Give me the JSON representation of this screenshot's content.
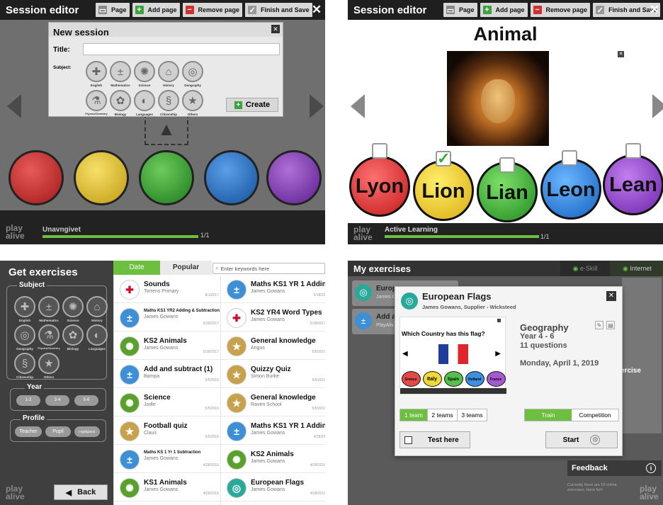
{
  "p1": {
    "title": "Session editor",
    "toolbar": {
      "page": "Page",
      "add": "Add page",
      "remove": "Remove page",
      "finish": "Finish and Save"
    },
    "dialog": {
      "heading": "New session",
      "title_label": "Title:",
      "title_value": "",
      "subject_label": "Subject:",
      "create": "Create",
      "subjects": [
        "English",
        "Mathematics",
        "Science",
        "History",
        "Geography",
        "Physics/Chemistry",
        "Biology",
        "Languages",
        "Citizenship",
        "Others"
      ]
    },
    "session_name": "Unavngivet",
    "page_count": "1/1",
    "logo": "play alive"
  },
  "p2": {
    "title": "Session editor",
    "toolbar": {
      "page": "Page",
      "add": "Add page",
      "remove": "Remove page",
      "finish": "Finish and Save"
    },
    "heading": "Animal",
    "answers": [
      "Lyon",
      "Lion",
      "Lian",
      "Leon",
      "Lean"
    ],
    "session_name": "Active Learning",
    "page_count": "1/1",
    "logo": "play alive"
  },
  "p3": {
    "title": "Get exercises",
    "subject_label": "Subject",
    "subjects": [
      "English",
      "Mathematics",
      "Science",
      "History",
      "Geography",
      "Physics/Chemistry",
      "Biology",
      "Languages",
      "Citizenship",
      "Others"
    ],
    "year_label": "Year",
    "years": [
      "1-2",
      "3-4",
      "5-6"
    ],
    "profile_label": "Profile",
    "profiles": [
      "Teacher",
      "Pupil",
      "Highlighted"
    ],
    "back": "Back",
    "logo": "play alive",
    "tabs": {
      "date": "Date",
      "popular": "Popular"
    },
    "search_placeholder": "Enter keywords here",
    "left_col": [
      {
        "title": "Sounds",
        "author": "Torrens Primary",
        "date": "8/1/2017",
        "icon": "uk-flag-icon",
        "small": false
      },
      {
        "title": "Maths KS1 YR2 Adding & Subtraction",
        "author": "James Gowans",
        "date": "5/18/2017",
        "icon": "math-icon",
        "small": true
      },
      {
        "title": "KS2 Animals",
        "author": "James Gowans",
        "date": "5/18/2017",
        "icon": "science-icon",
        "small": false
      },
      {
        "title": "Add and subtract (1)",
        "author": "Bampa",
        "date": "5/5/2016",
        "icon": "math-icon",
        "small": false
      },
      {
        "title": "Science",
        "author": "Jodle",
        "date": "5/5/2016",
        "icon": "science-icon",
        "small": false
      },
      {
        "title": "Football quiz",
        "author": "Claus",
        "date": "5/5/2016",
        "icon": "star-icon",
        "small": false
      },
      {
        "title": "Maths KS 1 Yr 1 Subtraction",
        "author": "James Gowans",
        "date": "4/28/2016",
        "icon": "math-icon",
        "small": true
      },
      {
        "title": "KS1 Animals",
        "author": "James Gowans",
        "date": "4/28/2016",
        "icon": "science-icon",
        "small": false
      }
    ],
    "right_col": [
      {
        "title": "Maths KS1 YR 1 Adding",
        "author": "James Gowans",
        "date": "5/18/2017",
        "icon": "math-icon",
        "small": false
      },
      {
        "title": "KS2 YR4 Word Types",
        "author": "James Gowans",
        "date": "5/18/2017",
        "icon": "uk-flag-icon",
        "small": false
      },
      {
        "title": "General knowledge",
        "author": "Angus",
        "date": "5/5/2016",
        "icon": "star-icon",
        "small": false
      },
      {
        "title": "Quizzy Quiz",
        "author": "Simon Burke",
        "date": "5/5/2016",
        "icon": "star-icon",
        "small": false
      },
      {
        "title": "General knowledge",
        "author": "Raven School",
        "date": "5/5/2016",
        "icon": "star-icon",
        "small": false
      },
      {
        "title": "Maths KS1 YR 1 Adding",
        "author": "James Gowans",
        "date": "4/28/2016",
        "icon": "math-icon",
        "small": false
      },
      {
        "title": "KS2 Animals",
        "author": "James Gowans",
        "date": "4/28/2016",
        "icon": "science-icon",
        "small": false
      },
      {
        "title": "European Flags",
        "author": "James Gowans",
        "date": "4/28/2016",
        "icon": "geography-icon",
        "small": false
      }
    ]
  },
  "p4": {
    "title": "My exercises",
    "e_skill": "e-Skill",
    "internet": "Internet",
    "list": [
      {
        "title": "Europ",
        "author": "James G"
      },
      {
        "title": "Add an",
        "author": "PlayAliv"
      }
    ],
    "dialog": {
      "title": "European Flags",
      "author": "James Gowans,  Supplier - Wicksteed",
      "question": "Which Country has this flag?",
      "answers": [
        "Greece",
        "Italy",
        "Spain",
        "Holland",
        "France"
      ],
      "subject": "Geography",
      "year": "Year 4 - 6",
      "questions": "11 questions",
      "date": "Monday, April 1, 2019",
      "teams": [
        "1 team",
        "2 teams",
        "3 teams"
      ],
      "modes": [
        "Train",
        "Competition"
      ],
      "test": "Test here",
      "start": "Start"
    },
    "exercise_label": "ercise",
    "feedback": "Feedback",
    "footer": "Currently there are 25 online exercises. Have fun!",
    "logo": "play alive"
  }
}
